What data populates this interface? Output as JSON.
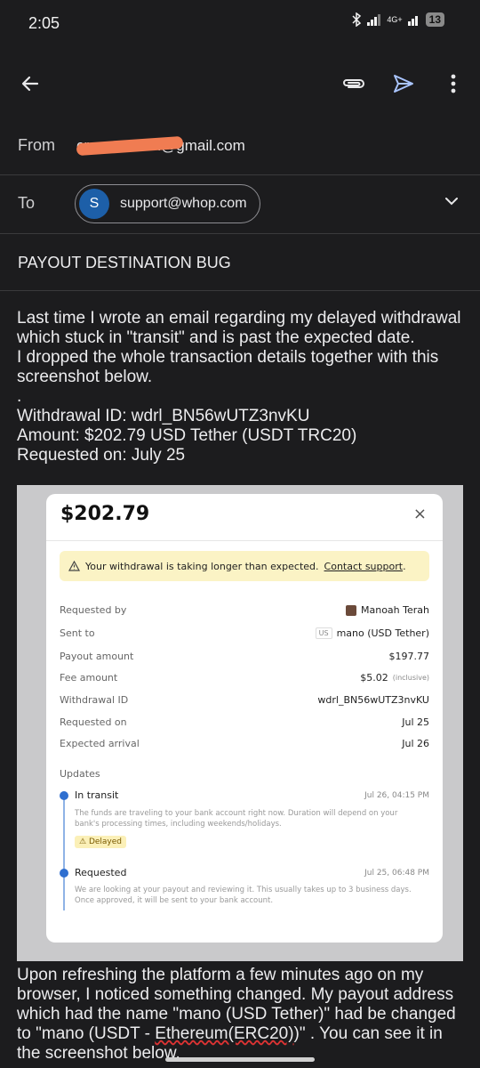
{
  "status_bar": {
    "time": "2:05",
    "network": "4G+",
    "battery": "13"
  },
  "toolbar": {
    "back_icon": "arrow-left-icon",
    "attach_icon": "paperclip-icon",
    "send_icon": "send-icon",
    "more_icon": "more-vert-icon"
  },
  "compose": {
    "from_label": "From",
    "from_value": "cr••••••••••••n@gmail.com",
    "to_label": "To",
    "to_chip_initial": "S",
    "to_chip_email": "support@whop.com",
    "subject": "PAYOUT DESTINATION BUG",
    "body_before": "Last time I wrote an email regarding my delayed withdrawal which stuck in \"transit\" and is past the expected date.\nI dropped the whole transaction details together with this screenshot below.\n.\nWithdrawal ID: wdrl_BN56wUTZ3nvKU\nAmount: $202.79 USD Tether (USDT TRC20)\nRequested on: July 25",
    "body_after_1": "Upon refreshing the platform a few minutes ago on my browser, I noticed something changed. My payout address which had the name \"mano (USD Tether)\" had be changed to \"mano (USDT - ",
    "body_after_misspelled": "Ethereum(ERC20)",
    "body_after_2": ")\" . You can see it in the screenshot below."
  },
  "embedded": {
    "amount": "$202.79",
    "close": "×",
    "warning": "Your withdrawal is taking longer than expected.",
    "warning_link": "Contact support",
    "warning_end": ".",
    "details": [
      {
        "label": "Requested by",
        "value": "Manoah Terah"
      },
      {
        "label": "Sent to",
        "tag": "US",
        "value": "mano (USD Tether)"
      },
      {
        "label": "Payout amount",
        "value": "$197.77"
      },
      {
        "label": "Fee amount",
        "value": "$5.02",
        "extra": "(inclusive)"
      },
      {
        "label": "Withdrawal ID",
        "value": "wdrl_BN56wUTZ3nvKU"
      },
      {
        "label": "Requested on",
        "value": "Jul 25"
      },
      {
        "label": "Expected arrival",
        "value": "Jul 26"
      }
    ],
    "updates_label": "Updates",
    "timeline": [
      {
        "title": "In transit",
        "date": "Jul 26, 04:15 PM",
        "desc": "The funds are traveling to your bank account right now. Duration will depend on your bank's processing times, including weekends/holidays.",
        "badge": "Delayed"
      },
      {
        "title": "Requested",
        "date": "Jul 25, 06:48 PM",
        "desc": "We are looking at your payout and reviewing it. This usually takes up to 3 business days. Once approved, it will be sent to your bank account."
      }
    ]
  }
}
